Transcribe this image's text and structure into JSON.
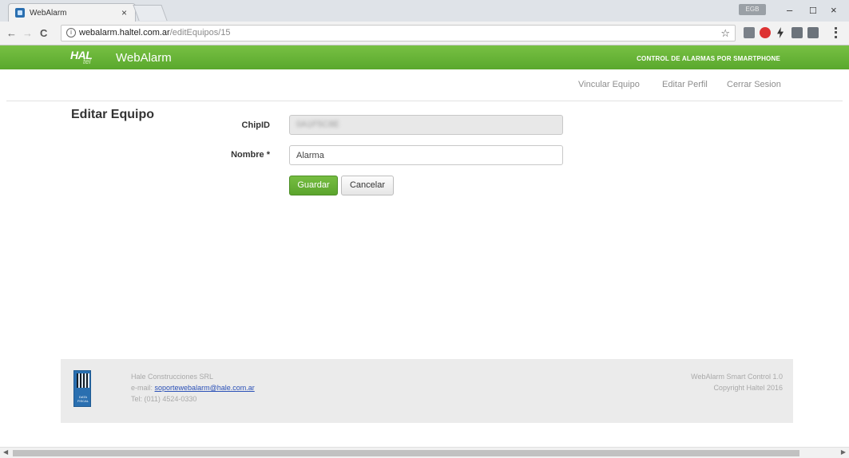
{
  "browser": {
    "tab_title": "WebAlarm",
    "tab_close": "×",
    "profile": "EGB",
    "min": "–",
    "max": "☐",
    "close": "×",
    "url_host": "webalarm.haltel.com.ar",
    "url_path": "/editEquipos/15",
    "back": "←",
    "forward": "→",
    "reload": "C",
    "star": "☆"
  },
  "header": {
    "logo": "HAL",
    "logo_sub": "tel",
    "brand": "WebAlarm",
    "tagline": "CONTROL DE ALARMAS POR SMARTPHONE"
  },
  "nav": {
    "vincular": "Vincular Equipo",
    "editar": "Editar Perfil",
    "cerrar": "Cerrar Sesion"
  },
  "form": {
    "title": "Editar Equipo",
    "chipid_label": "ChipID",
    "chipid_value": "0A1F5C8E",
    "nombre_label": "Nombre *",
    "nombre_value": "Alarma",
    "save": "Guardar",
    "cancel": "Cancelar"
  },
  "footer": {
    "company": "Hale Construcciones SRL",
    "email_label": "e-mail:",
    "email": "soportewebalarm@hale.com.ar",
    "phone": "Tel: (011) 4524-0330",
    "product": "WebAlarm Smart Control 1.0",
    "copyright": "Copyright Haltel 2016",
    "qr_text": "DATA FISCAL"
  }
}
